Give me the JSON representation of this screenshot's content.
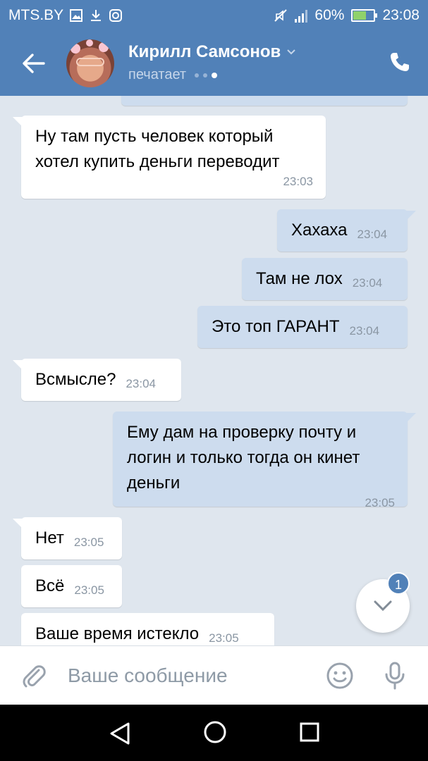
{
  "status_bar": {
    "carrier": "MTS.BY",
    "battery": "60%",
    "battery_level": 0.6,
    "time": "23:08"
  },
  "header": {
    "contact_name": "Кирилл Самсонов",
    "status": "печатает",
    "colors": {
      "bar": "#5181b8"
    },
    "icons": [
      "back-arrow-icon",
      "chevron-down-icon",
      "phone-icon"
    ]
  },
  "messages": [
    {
      "dir": "in",
      "text": "Ну там пусть человек который хотел купить деньги переводит",
      "time": "23:03"
    },
    {
      "dir": "out",
      "text": "Хахаха",
      "time": "23:04"
    },
    {
      "dir": "out",
      "text": "Там не лох",
      "time": "23:04"
    },
    {
      "dir": "out",
      "text": "Это топ ГАРАНТ",
      "time": "23:04"
    },
    {
      "dir": "in",
      "text": "Всмысле?",
      "time": "23:04"
    },
    {
      "dir": "out",
      "text": "Ему дам на проверку почту и логин и только тогда он кинет деньги",
      "time": "23:05"
    },
    {
      "dir": "in",
      "text": "Нет",
      "time": "23:05"
    },
    {
      "dir": "in",
      "text": "Всё",
      "time": "23:05"
    },
    {
      "dir": "in",
      "text": "Ваше время истекло",
      "time": "23:05"
    }
  ],
  "scroll_down": {
    "unread_count": "1"
  },
  "compose": {
    "placeholder": "Ваше сообщение",
    "icons": [
      "attach-clip-icon",
      "emoji-icon",
      "microphone-icon"
    ]
  },
  "colors": {
    "incoming_bubble": "#ffffff",
    "outgoing_bubble": "#cddcee",
    "chat_background": "#dfe6ee"
  }
}
